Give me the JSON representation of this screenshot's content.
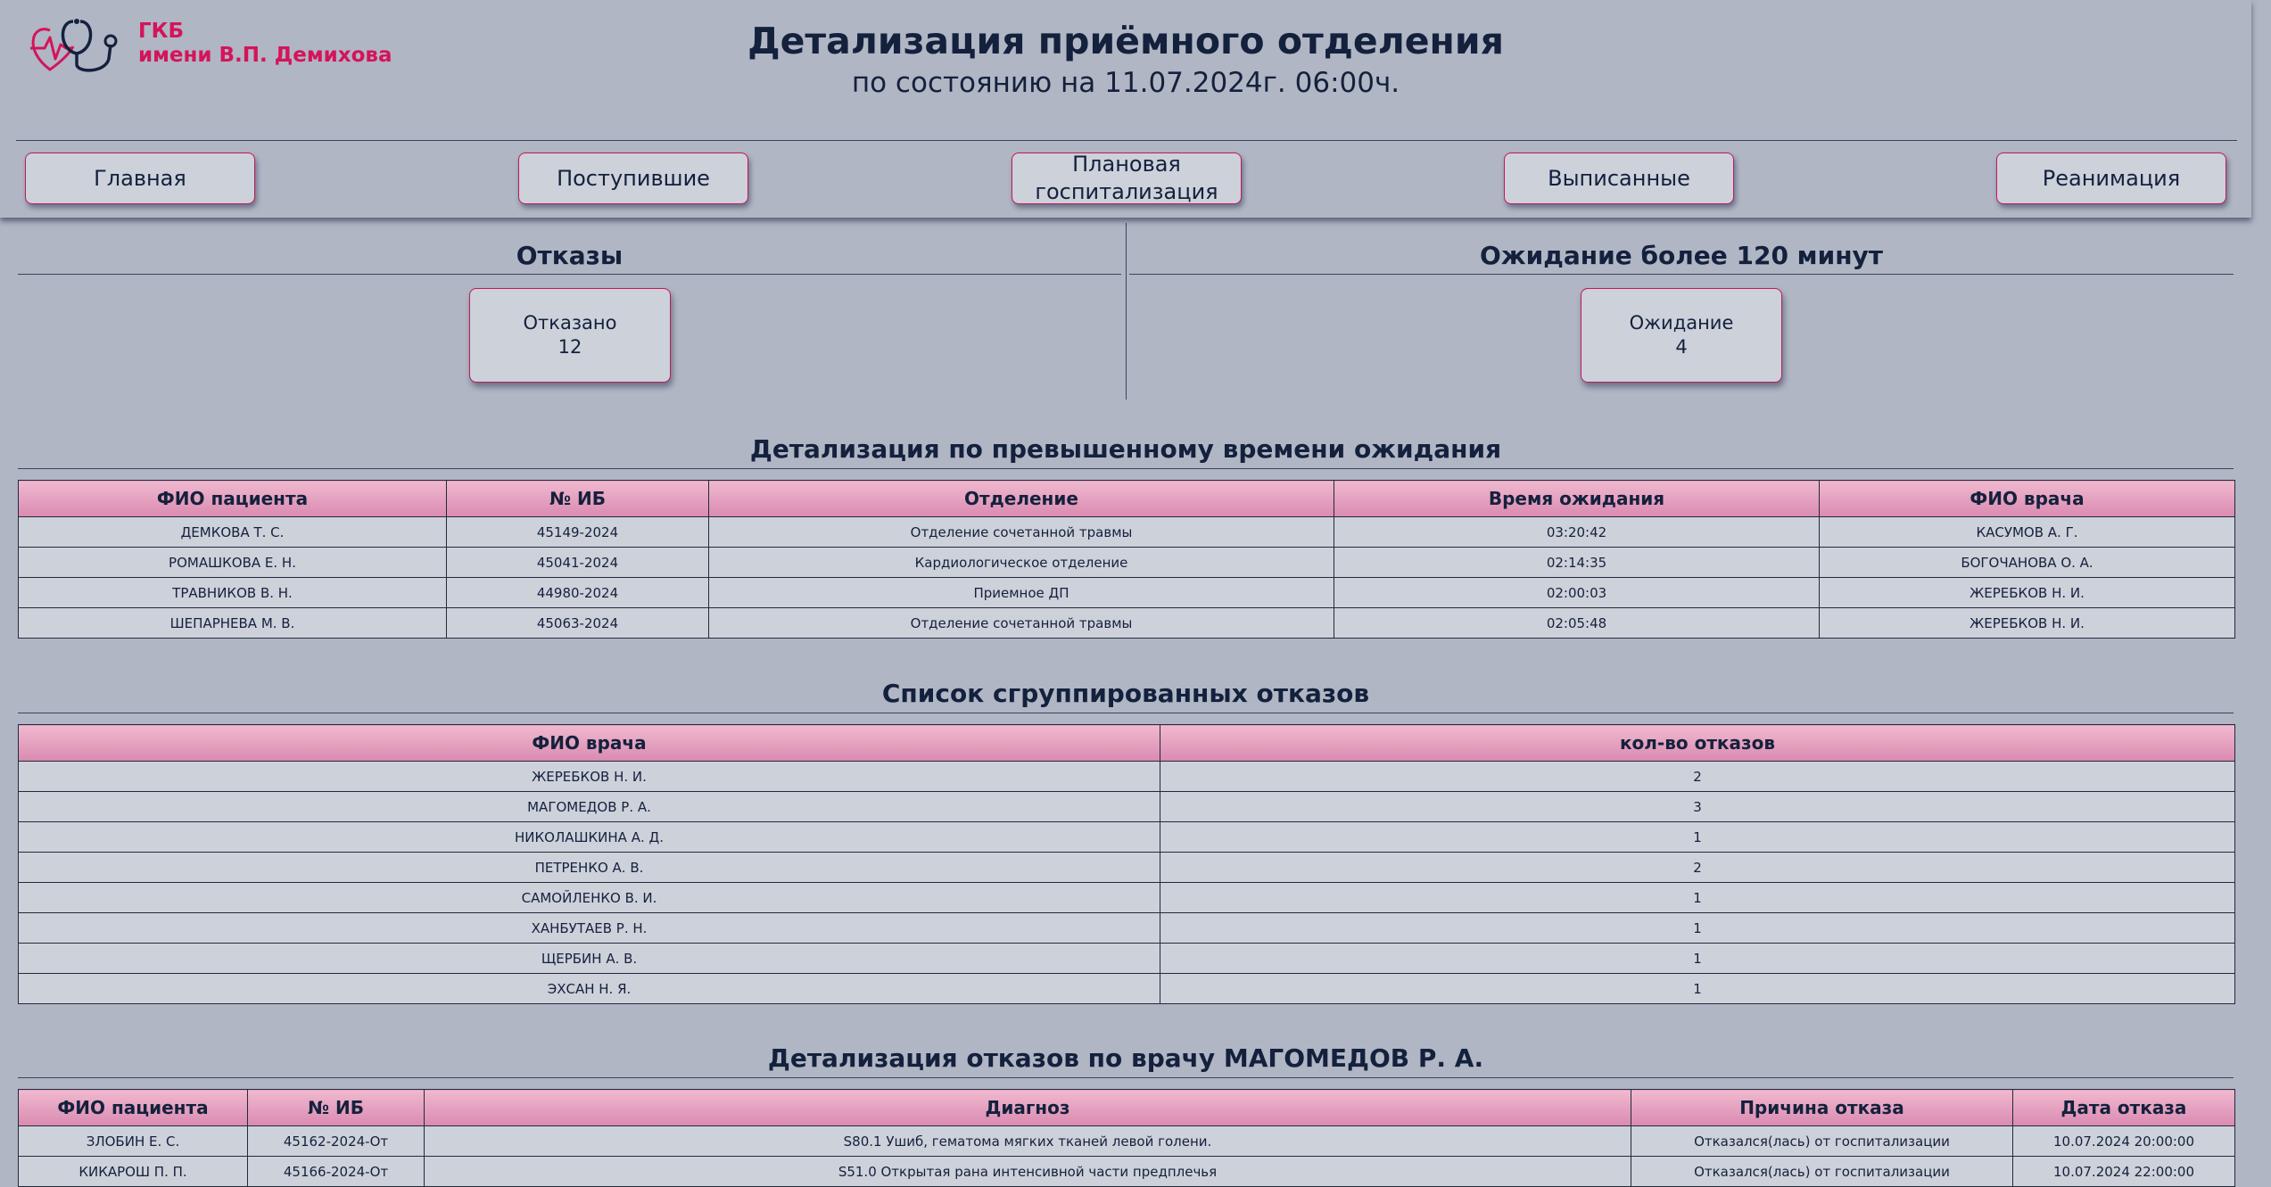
{
  "logo": {
    "line1": "ГКБ",
    "line2": "имени В.П. Демихова",
    "icon": "stethoscope-heart-icon"
  },
  "header": {
    "title": "Детализация приёмного отделения",
    "subtitle": "по состоянию на 11.07.2024г. 06:00ч."
  },
  "nav": {
    "main": "Главная",
    "admitted": "Поступившие",
    "planned": "Плановая госпитализация",
    "discharged": "Выписанные",
    "icu": "Реанимация"
  },
  "summary": {
    "refusals": {
      "title": "Отказы",
      "label": "Отказано",
      "value": "12"
    },
    "waiting": {
      "title": "Ожидание более 120 минут",
      "label": "Ожидание",
      "value": "4"
    }
  },
  "waiting_table": {
    "title": "Детализация по превышенному времени ожидания",
    "headers": [
      "ФИО пациента",
      "№ ИБ",
      "Отделение",
      "Время ожидания",
      "ФИО врача"
    ],
    "rows": [
      [
        "ДЕМКОВА Т. С.",
        "45149-2024",
        "Отделение сочетанной травмы",
        "03:20:42",
        "КАСУМОВ А. Г."
      ],
      [
        "РОМАШКОВА Е. Н.",
        "45041-2024",
        "Кардиологическое отделение",
        "02:14:35",
        "БОГОЧАНОВА О. А."
      ],
      [
        "ТРАВНИКОВ В. Н.",
        "44980-2024",
        "Приемное ДП",
        "02:00:03",
        "ЖЕРЕБКОВ Н. И."
      ],
      [
        "ШЕПАРНЕВА М. В.",
        "45063-2024",
        "Отделение сочетанной травмы",
        "02:05:48",
        "ЖЕРЕБКОВ Н. И."
      ]
    ]
  },
  "grouped_table": {
    "title": "Список сгруппированных отказов",
    "headers": [
      "ФИО врача",
      "кол-во отказов"
    ],
    "rows": [
      [
        "ЖЕРЕБКОВ Н. И.",
        "2"
      ],
      [
        "МАГОМЕДОВ Р. А.",
        "3"
      ],
      [
        "НИКОЛАШКИНА А. Д.",
        "1"
      ],
      [
        "ПЕТРЕНКО А. В.",
        "2"
      ],
      [
        "САМОЙЛЕНКО В. И.",
        "1"
      ],
      [
        "ХАНБУТАЕВ Р. Н.",
        "1"
      ],
      [
        "ЩЕРБИН А. В.",
        "1"
      ],
      [
        "ЭХСАН Н. Я.",
        "1"
      ]
    ]
  },
  "doctor_table": {
    "title": "Детализация отказов по врачу МАГОМЕДОВ Р. А.",
    "headers": [
      "ФИО пациента",
      "№ ИБ",
      "Диагноз",
      "Причина отказа",
      "Дата отказа"
    ],
    "rows": [
      [
        "ЗЛОБИН Е. С.",
        "45162-2024-От",
        "S80.1 Ушиб, гематома мягких тканей левой голени.",
        "Отказался(лась) от госпитализации",
        "10.07.2024 20:00:00"
      ],
      [
        "КИКАРОШ П. П.",
        "45166-2024-От",
        "S51.0 Открытая рана интенсивной части предплечья",
        "Отказался(лась) от госпитализации",
        "10.07.2024 22:00:00"
      ]
    ]
  }
}
